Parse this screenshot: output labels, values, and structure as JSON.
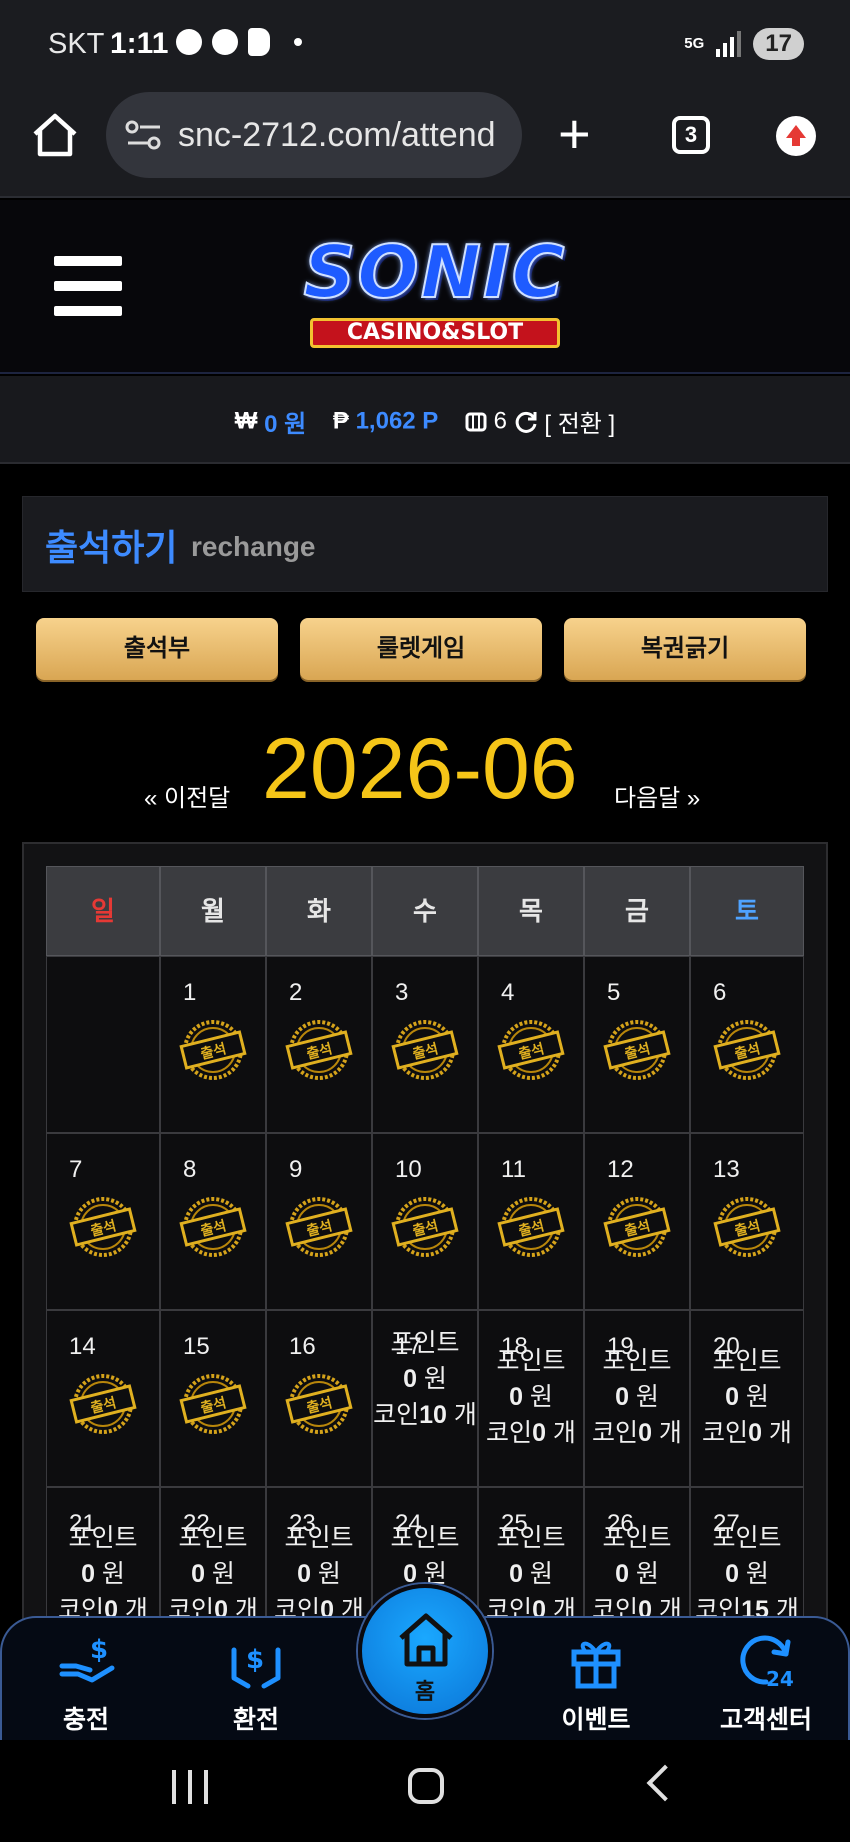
{
  "status_bar": {
    "carrier": "SKT",
    "time": "1:11",
    "network": "5G",
    "battery": "17"
  },
  "browser": {
    "url": "snc-2712.com/attend",
    "tab_count": "3"
  },
  "site": {
    "logo_main": "SONIC",
    "logo_sub": "CASINO&SLOT"
  },
  "balance": {
    "money_symbol": "₩",
    "money": "0 원",
    "point_symbol": "₱",
    "points": "1,062 P",
    "ticket_count": "6",
    "switch_label": "[ 전환 ]"
  },
  "section": {
    "title": "출석하기",
    "subtitle": "rechange"
  },
  "buttons": {
    "attendance": "출석부",
    "roulette": "룰렛게임",
    "lottery": "복권긁기"
  },
  "month_nav": {
    "prev": "« 이전달",
    "current": "2026-06",
    "next": "다음달 »"
  },
  "calendar": {
    "weekdays": [
      "일",
      "월",
      "화",
      "수",
      "목",
      "금",
      "토"
    ],
    "stamp_label": "출석",
    "point_label": "포인트",
    "coin_label": "코인",
    "won_unit": "원",
    "coin_unit": "개",
    "weeks": [
      [
        {
          "day": "",
          "type": "empty"
        },
        {
          "day": "1",
          "type": "stamp"
        },
        {
          "day": "2",
          "type": "stamp"
        },
        {
          "day": "3",
          "type": "stamp"
        },
        {
          "day": "4",
          "type": "stamp"
        },
        {
          "day": "5",
          "type": "stamp"
        },
        {
          "day": "6",
          "type": "stamp"
        }
      ],
      [
        {
          "day": "7",
          "type": "stamp"
        },
        {
          "day": "8",
          "type": "stamp"
        },
        {
          "day": "9",
          "type": "stamp"
        },
        {
          "day": "10",
          "type": "stamp"
        },
        {
          "day": "11",
          "type": "stamp"
        },
        {
          "day": "12",
          "type": "stamp"
        },
        {
          "day": "13",
          "type": "stamp"
        }
      ],
      [
        {
          "day": "14",
          "type": "stamp"
        },
        {
          "day": "15",
          "type": "stamp"
        },
        {
          "day": "16",
          "type": "stamp"
        },
        {
          "day": "17",
          "type": "info",
          "points": "0",
          "coins": "10"
        },
        {
          "day": "18",
          "type": "info",
          "points": "0",
          "coins": "0"
        },
        {
          "day": "19",
          "type": "info",
          "points": "0",
          "coins": "0"
        },
        {
          "day": "20",
          "type": "info",
          "points": "0",
          "coins": "0"
        }
      ],
      [
        {
          "day": "21",
          "type": "info",
          "points": "0",
          "coins": "0"
        },
        {
          "day": "22",
          "type": "info",
          "points": "0",
          "coins": "0"
        },
        {
          "day": "23",
          "type": "info",
          "points": "0",
          "coins": "0"
        },
        {
          "day": "24",
          "type": "info",
          "points": "0",
          "coins": "0"
        },
        {
          "day": "25",
          "type": "info",
          "points": "0",
          "coins": "0"
        },
        {
          "day": "26",
          "type": "info",
          "points": "0",
          "coins": "0"
        },
        {
          "day": "27",
          "type": "info",
          "points": "0",
          "coins": "15"
        }
      ]
    ]
  },
  "bottom_nav": {
    "deposit": "충전",
    "withdraw": "환전",
    "home": "홈",
    "event": "이벤트",
    "support": "고객센터"
  },
  "colors": {
    "accent_blue": "#3d8bff",
    "gold": "#f5c518",
    "sunday": "#e53935",
    "saturday": "#4fa3ff"
  }
}
